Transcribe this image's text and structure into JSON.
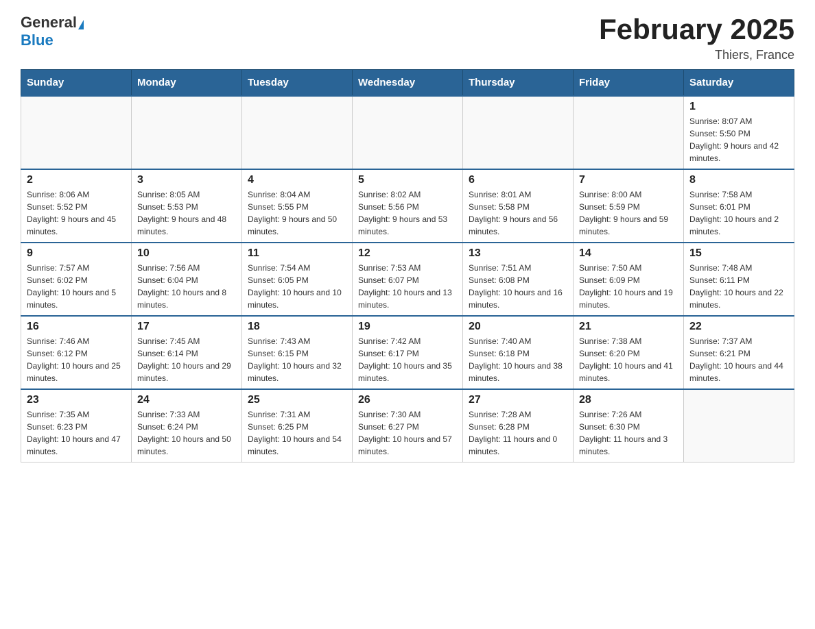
{
  "header": {
    "logo_general": "General",
    "logo_blue": "Blue",
    "month_title": "February 2025",
    "location": "Thiers, France"
  },
  "days_of_week": [
    "Sunday",
    "Monday",
    "Tuesday",
    "Wednesday",
    "Thursday",
    "Friday",
    "Saturday"
  ],
  "weeks": [
    [
      {
        "day": "",
        "info": ""
      },
      {
        "day": "",
        "info": ""
      },
      {
        "day": "",
        "info": ""
      },
      {
        "day": "",
        "info": ""
      },
      {
        "day": "",
        "info": ""
      },
      {
        "day": "",
        "info": ""
      },
      {
        "day": "1",
        "info": "Sunrise: 8:07 AM\nSunset: 5:50 PM\nDaylight: 9 hours and 42 minutes."
      }
    ],
    [
      {
        "day": "2",
        "info": "Sunrise: 8:06 AM\nSunset: 5:52 PM\nDaylight: 9 hours and 45 minutes."
      },
      {
        "day": "3",
        "info": "Sunrise: 8:05 AM\nSunset: 5:53 PM\nDaylight: 9 hours and 48 minutes."
      },
      {
        "day": "4",
        "info": "Sunrise: 8:04 AM\nSunset: 5:55 PM\nDaylight: 9 hours and 50 minutes."
      },
      {
        "day": "5",
        "info": "Sunrise: 8:02 AM\nSunset: 5:56 PM\nDaylight: 9 hours and 53 minutes."
      },
      {
        "day": "6",
        "info": "Sunrise: 8:01 AM\nSunset: 5:58 PM\nDaylight: 9 hours and 56 minutes."
      },
      {
        "day": "7",
        "info": "Sunrise: 8:00 AM\nSunset: 5:59 PM\nDaylight: 9 hours and 59 minutes."
      },
      {
        "day": "8",
        "info": "Sunrise: 7:58 AM\nSunset: 6:01 PM\nDaylight: 10 hours and 2 minutes."
      }
    ],
    [
      {
        "day": "9",
        "info": "Sunrise: 7:57 AM\nSunset: 6:02 PM\nDaylight: 10 hours and 5 minutes."
      },
      {
        "day": "10",
        "info": "Sunrise: 7:56 AM\nSunset: 6:04 PM\nDaylight: 10 hours and 8 minutes."
      },
      {
        "day": "11",
        "info": "Sunrise: 7:54 AM\nSunset: 6:05 PM\nDaylight: 10 hours and 10 minutes."
      },
      {
        "day": "12",
        "info": "Sunrise: 7:53 AM\nSunset: 6:07 PM\nDaylight: 10 hours and 13 minutes."
      },
      {
        "day": "13",
        "info": "Sunrise: 7:51 AM\nSunset: 6:08 PM\nDaylight: 10 hours and 16 minutes."
      },
      {
        "day": "14",
        "info": "Sunrise: 7:50 AM\nSunset: 6:09 PM\nDaylight: 10 hours and 19 minutes."
      },
      {
        "day": "15",
        "info": "Sunrise: 7:48 AM\nSunset: 6:11 PM\nDaylight: 10 hours and 22 minutes."
      }
    ],
    [
      {
        "day": "16",
        "info": "Sunrise: 7:46 AM\nSunset: 6:12 PM\nDaylight: 10 hours and 25 minutes."
      },
      {
        "day": "17",
        "info": "Sunrise: 7:45 AM\nSunset: 6:14 PM\nDaylight: 10 hours and 29 minutes."
      },
      {
        "day": "18",
        "info": "Sunrise: 7:43 AM\nSunset: 6:15 PM\nDaylight: 10 hours and 32 minutes."
      },
      {
        "day": "19",
        "info": "Sunrise: 7:42 AM\nSunset: 6:17 PM\nDaylight: 10 hours and 35 minutes."
      },
      {
        "day": "20",
        "info": "Sunrise: 7:40 AM\nSunset: 6:18 PM\nDaylight: 10 hours and 38 minutes."
      },
      {
        "day": "21",
        "info": "Sunrise: 7:38 AM\nSunset: 6:20 PM\nDaylight: 10 hours and 41 minutes."
      },
      {
        "day": "22",
        "info": "Sunrise: 7:37 AM\nSunset: 6:21 PM\nDaylight: 10 hours and 44 minutes."
      }
    ],
    [
      {
        "day": "23",
        "info": "Sunrise: 7:35 AM\nSunset: 6:23 PM\nDaylight: 10 hours and 47 minutes."
      },
      {
        "day": "24",
        "info": "Sunrise: 7:33 AM\nSunset: 6:24 PM\nDaylight: 10 hours and 50 minutes."
      },
      {
        "day": "25",
        "info": "Sunrise: 7:31 AM\nSunset: 6:25 PM\nDaylight: 10 hours and 54 minutes."
      },
      {
        "day": "26",
        "info": "Sunrise: 7:30 AM\nSunset: 6:27 PM\nDaylight: 10 hours and 57 minutes."
      },
      {
        "day": "27",
        "info": "Sunrise: 7:28 AM\nSunset: 6:28 PM\nDaylight: 11 hours and 0 minutes."
      },
      {
        "day": "28",
        "info": "Sunrise: 7:26 AM\nSunset: 6:30 PM\nDaylight: 11 hours and 3 minutes."
      },
      {
        "day": "",
        "info": ""
      }
    ]
  ]
}
